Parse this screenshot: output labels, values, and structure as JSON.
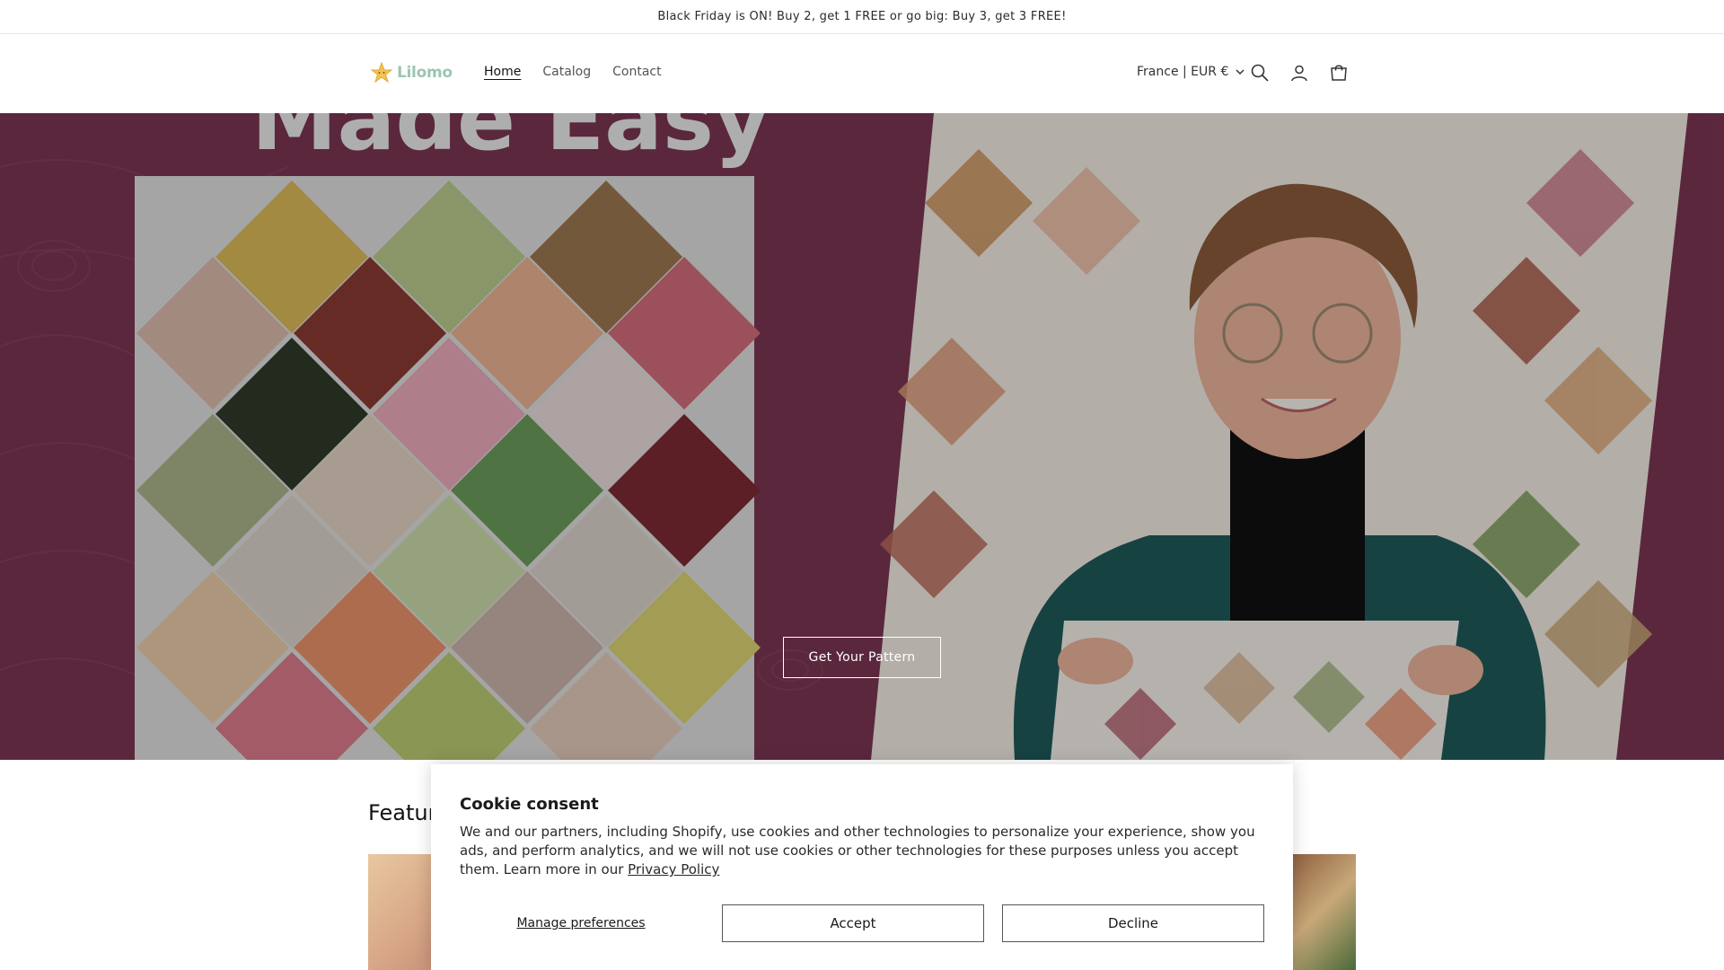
{
  "announcement": {
    "text": "Black Friday is ON! Buy 2, get 1 FREE or go big: Buy 3, get 3 FREE!"
  },
  "header": {
    "logo_text": "Lilomo",
    "nav": [
      {
        "label": "Home",
        "active": true
      },
      {
        "label": "Catalog",
        "active": false
      },
      {
        "label": "Contact",
        "active": false
      }
    ],
    "locale": "France | EUR €",
    "icons": [
      "search-icon",
      "account-icon",
      "cart-icon"
    ]
  },
  "hero": {
    "banner_text": "Made Easy",
    "button_label": "Get Your Pattern"
  },
  "featured": {
    "title": "Featured"
  },
  "cookie": {
    "title": "Cookie consent",
    "text": "We and our partners, including Shopify, use cookies and other technologies to personalize your experience, show you ads, and perform analytics, and we will not use cookies or other technologies for these purposes unless you accept them. Learn more in our",
    "link_label": "Privacy Policy",
    "manage_label": "Manage preferences",
    "accept_label": "Accept",
    "decline_label": "Decline"
  },
  "colors": {
    "hero_bg": "#6a3148",
    "logo": "#9cc5b0"
  }
}
